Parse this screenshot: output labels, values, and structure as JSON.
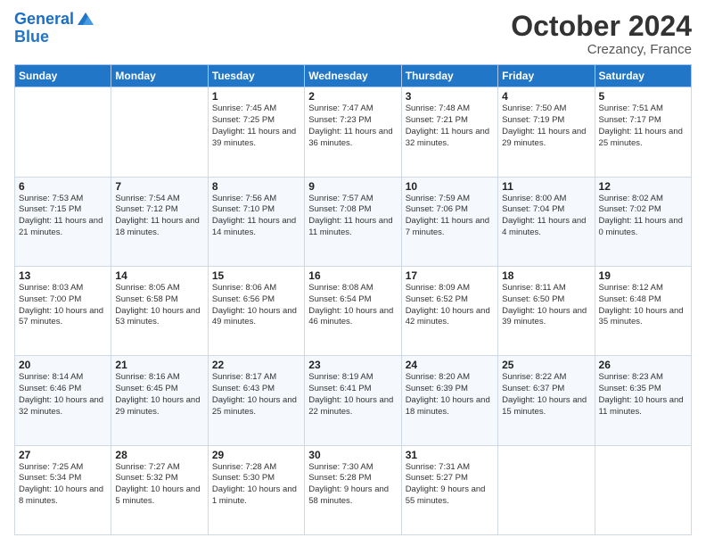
{
  "header": {
    "logo_line1": "General",
    "logo_line2": "Blue",
    "month_title": "October 2024",
    "location": "Crezancy, France"
  },
  "weekdays": [
    "Sunday",
    "Monday",
    "Tuesday",
    "Wednesday",
    "Thursday",
    "Friday",
    "Saturday"
  ],
  "weeks": [
    [
      {
        "day": "",
        "sunrise": "",
        "sunset": "",
        "daylight": ""
      },
      {
        "day": "",
        "sunrise": "",
        "sunset": "",
        "daylight": ""
      },
      {
        "day": "1",
        "sunrise": "Sunrise: 7:45 AM",
        "sunset": "Sunset: 7:25 PM",
        "daylight": "Daylight: 11 hours and 39 minutes."
      },
      {
        "day": "2",
        "sunrise": "Sunrise: 7:47 AM",
        "sunset": "Sunset: 7:23 PM",
        "daylight": "Daylight: 11 hours and 36 minutes."
      },
      {
        "day": "3",
        "sunrise": "Sunrise: 7:48 AM",
        "sunset": "Sunset: 7:21 PM",
        "daylight": "Daylight: 11 hours and 32 minutes."
      },
      {
        "day": "4",
        "sunrise": "Sunrise: 7:50 AM",
        "sunset": "Sunset: 7:19 PM",
        "daylight": "Daylight: 11 hours and 29 minutes."
      },
      {
        "day": "5",
        "sunrise": "Sunrise: 7:51 AM",
        "sunset": "Sunset: 7:17 PM",
        "daylight": "Daylight: 11 hours and 25 minutes."
      }
    ],
    [
      {
        "day": "6",
        "sunrise": "Sunrise: 7:53 AM",
        "sunset": "Sunset: 7:15 PM",
        "daylight": "Daylight: 11 hours and 21 minutes."
      },
      {
        "day": "7",
        "sunrise": "Sunrise: 7:54 AM",
        "sunset": "Sunset: 7:12 PM",
        "daylight": "Daylight: 11 hours and 18 minutes."
      },
      {
        "day": "8",
        "sunrise": "Sunrise: 7:56 AM",
        "sunset": "Sunset: 7:10 PM",
        "daylight": "Daylight: 11 hours and 14 minutes."
      },
      {
        "day": "9",
        "sunrise": "Sunrise: 7:57 AM",
        "sunset": "Sunset: 7:08 PM",
        "daylight": "Daylight: 11 hours and 11 minutes."
      },
      {
        "day": "10",
        "sunrise": "Sunrise: 7:59 AM",
        "sunset": "Sunset: 7:06 PM",
        "daylight": "Daylight: 11 hours and 7 minutes."
      },
      {
        "day": "11",
        "sunrise": "Sunrise: 8:00 AM",
        "sunset": "Sunset: 7:04 PM",
        "daylight": "Daylight: 11 hours and 4 minutes."
      },
      {
        "day": "12",
        "sunrise": "Sunrise: 8:02 AM",
        "sunset": "Sunset: 7:02 PM",
        "daylight": "Daylight: 11 hours and 0 minutes."
      }
    ],
    [
      {
        "day": "13",
        "sunrise": "Sunrise: 8:03 AM",
        "sunset": "Sunset: 7:00 PM",
        "daylight": "Daylight: 10 hours and 57 minutes."
      },
      {
        "day": "14",
        "sunrise": "Sunrise: 8:05 AM",
        "sunset": "Sunset: 6:58 PM",
        "daylight": "Daylight: 10 hours and 53 minutes."
      },
      {
        "day": "15",
        "sunrise": "Sunrise: 8:06 AM",
        "sunset": "Sunset: 6:56 PM",
        "daylight": "Daylight: 10 hours and 49 minutes."
      },
      {
        "day": "16",
        "sunrise": "Sunrise: 8:08 AM",
        "sunset": "Sunset: 6:54 PM",
        "daylight": "Daylight: 10 hours and 46 minutes."
      },
      {
        "day": "17",
        "sunrise": "Sunrise: 8:09 AM",
        "sunset": "Sunset: 6:52 PM",
        "daylight": "Daylight: 10 hours and 42 minutes."
      },
      {
        "day": "18",
        "sunrise": "Sunrise: 8:11 AM",
        "sunset": "Sunset: 6:50 PM",
        "daylight": "Daylight: 10 hours and 39 minutes."
      },
      {
        "day": "19",
        "sunrise": "Sunrise: 8:12 AM",
        "sunset": "Sunset: 6:48 PM",
        "daylight": "Daylight: 10 hours and 35 minutes."
      }
    ],
    [
      {
        "day": "20",
        "sunrise": "Sunrise: 8:14 AM",
        "sunset": "Sunset: 6:46 PM",
        "daylight": "Daylight: 10 hours and 32 minutes."
      },
      {
        "day": "21",
        "sunrise": "Sunrise: 8:16 AM",
        "sunset": "Sunset: 6:45 PM",
        "daylight": "Daylight: 10 hours and 29 minutes."
      },
      {
        "day": "22",
        "sunrise": "Sunrise: 8:17 AM",
        "sunset": "Sunset: 6:43 PM",
        "daylight": "Daylight: 10 hours and 25 minutes."
      },
      {
        "day": "23",
        "sunrise": "Sunrise: 8:19 AM",
        "sunset": "Sunset: 6:41 PM",
        "daylight": "Daylight: 10 hours and 22 minutes."
      },
      {
        "day": "24",
        "sunrise": "Sunrise: 8:20 AM",
        "sunset": "Sunset: 6:39 PM",
        "daylight": "Daylight: 10 hours and 18 minutes."
      },
      {
        "day": "25",
        "sunrise": "Sunrise: 8:22 AM",
        "sunset": "Sunset: 6:37 PM",
        "daylight": "Daylight: 10 hours and 15 minutes."
      },
      {
        "day": "26",
        "sunrise": "Sunrise: 8:23 AM",
        "sunset": "Sunset: 6:35 PM",
        "daylight": "Daylight: 10 hours and 11 minutes."
      }
    ],
    [
      {
        "day": "27",
        "sunrise": "Sunrise: 7:25 AM",
        "sunset": "Sunset: 5:34 PM",
        "daylight": "Daylight: 10 hours and 8 minutes."
      },
      {
        "day": "28",
        "sunrise": "Sunrise: 7:27 AM",
        "sunset": "Sunset: 5:32 PM",
        "daylight": "Daylight: 10 hours and 5 minutes."
      },
      {
        "day": "29",
        "sunrise": "Sunrise: 7:28 AM",
        "sunset": "Sunset: 5:30 PM",
        "daylight": "Daylight: 10 hours and 1 minute."
      },
      {
        "day": "30",
        "sunrise": "Sunrise: 7:30 AM",
        "sunset": "Sunset: 5:28 PM",
        "daylight": "Daylight: 9 hours and 58 minutes."
      },
      {
        "day": "31",
        "sunrise": "Sunrise: 7:31 AM",
        "sunset": "Sunset: 5:27 PM",
        "daylight": "Daylight: 9 hours and 55 minutes."
      },
      {
        "day": "",
        "sunrise": "",
        "sunset": "",
        "daylight": ""
      },
      {
        "day": "",
        "sunrise": "",
        "sunset": "",
        "daylight": ""
      }
    ]
  ]
}
